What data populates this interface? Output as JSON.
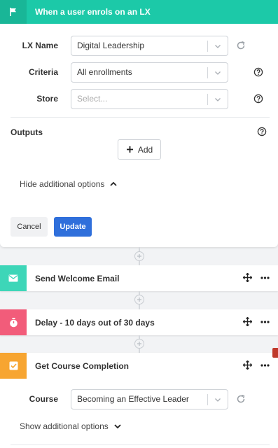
{
  "trigger": {
    "title": "When a user enrols on an LX",
    "header_color": "#1cc9a8",
    "icon": "flag-icon",
    "fields": {
      "lx_name": {
        "label": "LX Name",
        "value": "Digital Leadership"
      },
      "criteria": {
        "label": "Criteria",
        "value": "All enrollments"
      },
      "store": {
        "label": "Store",
        "placeholder": "Select..."
      }
    },
    "outputs_label": "Outputs",
    "add_label": "Add",
    "hide_options_label": "Hide additional options",
    "cancel_label": "Cancel",
    "update_label": "Update",
    "primary_color": "#2f6fdb"
  },
  "steps": [
    {
      "title": "Send Welcome Email",
      "icon": "envelope-icon",
      "color": "#3dd6b8"
    },
    {
      "title": "Delay - 10 days out of 30 days",
      "icon": "stopwatch-icon",
      "color": "#f25c7a"
    },
    {
      "title": "Get Course Completion",
      "icon": "checkbox-icon",
      "color": "#f7a531"
    }
  ],
  "course_step": {
    "course_label": "Course",
    "course_value": "Becoming an Effective Leader",
    "show_options_label": "Show additional options"
  }
}
